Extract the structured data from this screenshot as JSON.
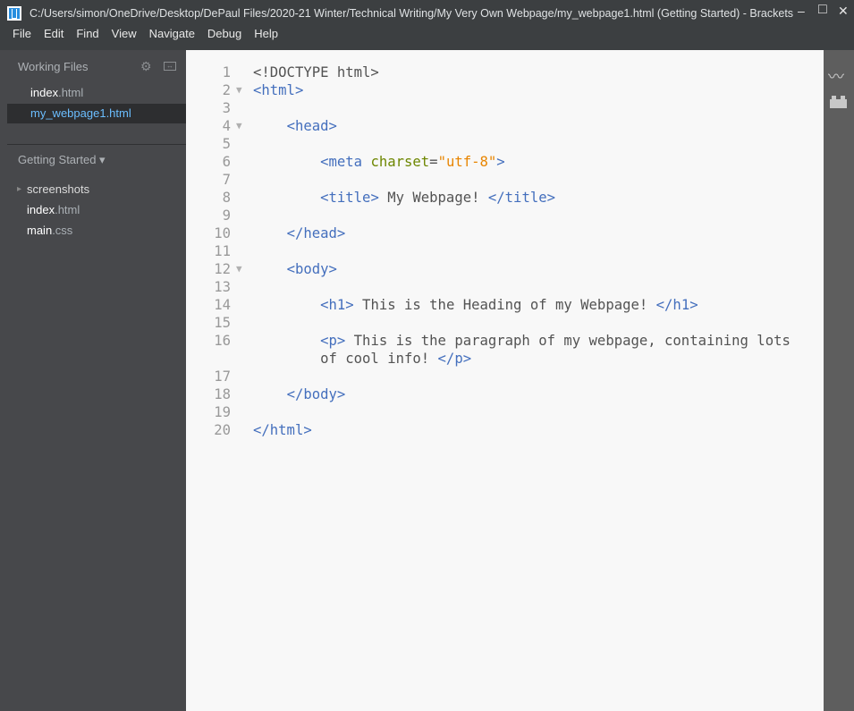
{
  "window": {
    "title": "C:/Users/simon/OneDrive/Desktop/DePaul Files/2020-21 Winter/Technical Writing/My Very Own Webpage/my_webpage1.html (Getting Started) - Brackets",
    "minimize": "–",
    "maximize": "□",
    "close": "✕"
  },
  "menu": [
    "File",
    "Edit",
    "Find",
    "View",
    "Navigate",
    "Debug",
    "Help"
  ],
  "sidebar": {
    "working_files_label": "Working Files",
    "working_files": [
      {
        "name": "index",
        "ext": ".html",
        "selected": false
      },
      {
        "name": "my_webpage1",
        "ext": ".html",
        "selected": true
      }
    ],
    "project_label": "Getting Started ▾",
    "tree": [
      {
        "arrow": "▸",
        "name": "screenshots",
        "ext": ""
      },
      {
        "name": "index",
        "ext": ".html"
      },
      {
        "name": "main",
        "ext": ".css"
      }
    ]
  },
  "editor": {
    "lines": [
      {
        "n": "1",
        "fold": "",
        "tokens": [
          [
            "x",
            "<!DOCTYPE html>"
          ]
        ]
      },
      {
        "n": "2",
        "fold": "▼",
        "tokens": [
          [
            "t",
            "<html>"
          ]
        ]
      },
      {
        "n": "3",
        "fold": "",
        "tokens": []
      },
      {
        "n": "4",
        "fold": "▼",
        "tokens": [
          [
            "x",
            "    "
          ],
          [
            "t",
            "<head>"
          ]
        ]
      },
      {
        "n": "5",
        "fold": "",
        "tokens": []
      },
      {
        "n": "6",
        "fold": "",
        "tokens": [
          [
            "x",
            "        "
          ],
          [
            "t",
            "<meta "
          ],
          [
            "a",
            "charset"
          ],
          [
            "x",
            "="
          ],
          [
            "v",
            "\"utf-8\""
          ],
          [
            "t",
            ">"
          ]
        ]
      },
      {
        "n": "7",
        "fold": "",
        "tokens": []
      },
      {
        "n": "8",
        "fold": "",
        "tokens": [
          [
            "x",
            "        "
          ],
          [
            "t",
            "<title>"
          ],
          [
            "x",
            " My Webpage! "
          ],
          [
            "t",
            "</title>"
          ]
        ]
      },
      {
        "n": "9",
        "fold": "",
        "tokens": []
      },
      {
        "n": "10",
        "fold": "",
        "tokens": [
          [
            "x",
            "    "
          ],
          [
            "t",
            "</head>"
          ]
        ]
      },
      {
        "n": "11",
        "fold": "",
        "tokens": []
      },
      {
        "n": "12",
        "fold": "▼",
        "tokens": [
          [
            "x",
            "    "
          ],
          [
            "t",
            "<body>"
          ]
        ]
      },
      {
        "n": "13",
        "fold": "",
        "tokens": []
      },
      {
        "n": "14",
        "fold": "",
        "tokens": [
          [
            "x",
            "        "
          ],
          [
            "t",
            "<h1>"
          ],
          [
            "x",
            " This is the Heading of my Webpage! "
          ],
          [
            "t",
            "</h1>"
          ]
        ]
      },
      {
        "n": "15",
        "fold": "",
        "tokens": []
      },
      {
        "n": "16",
        "fold": "",
        "tokens": [
          [
            "x",
            "        "
          ],
          [
            "t",
            "<p>"
          ],
          [
            "x",
            " This is the paragraph of my webpage, containing lots"
          ]
        ]
      },
      {
        "n": "",
        "fold": "",
        "tokens": [
          [
            "x",
            "        of cool info! "
          ],
          [
            "t",
            "</p>"
          ]
        ]
      },
      {
        "n": "17",
        "fold": "",
        "tokens": []
      },
      {
        "n": "18",
        "fold": "",
        "tokens": [
          [
            "x",
            "    "
          ],
          [
            "t",
            "</body>"
          ]
        ]
      },
      {
        "n": "19",
        "fold": "",
        "tokens": []
      },
      {
        "n": "20",
        "fold": "",
        "tokens": [
          [
            "t",
            "</html>"
          ]
        ]
      }
    ]
  }
}
